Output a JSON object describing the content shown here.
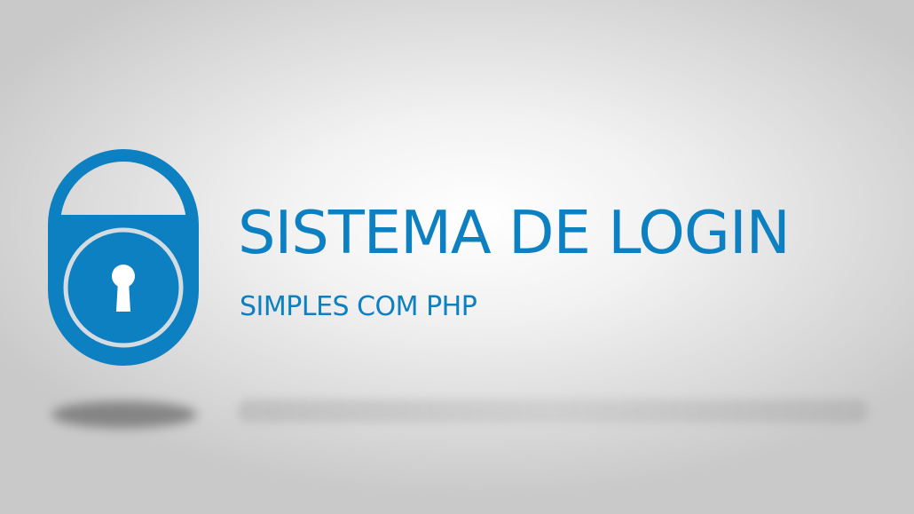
{
  "banner": {
    "title": "SISTEMA DE LOGIN",
    "subtitle": "SIMPLES COM PHP",
    "icon": "padlock-icon"
  },
  "colors": {
    "accent": "#0d80c1",
    "keyhole": "#ffffff",
    "background_center": "#ffffff",
    "background_edge": "#c9c9c9"
  }
}
